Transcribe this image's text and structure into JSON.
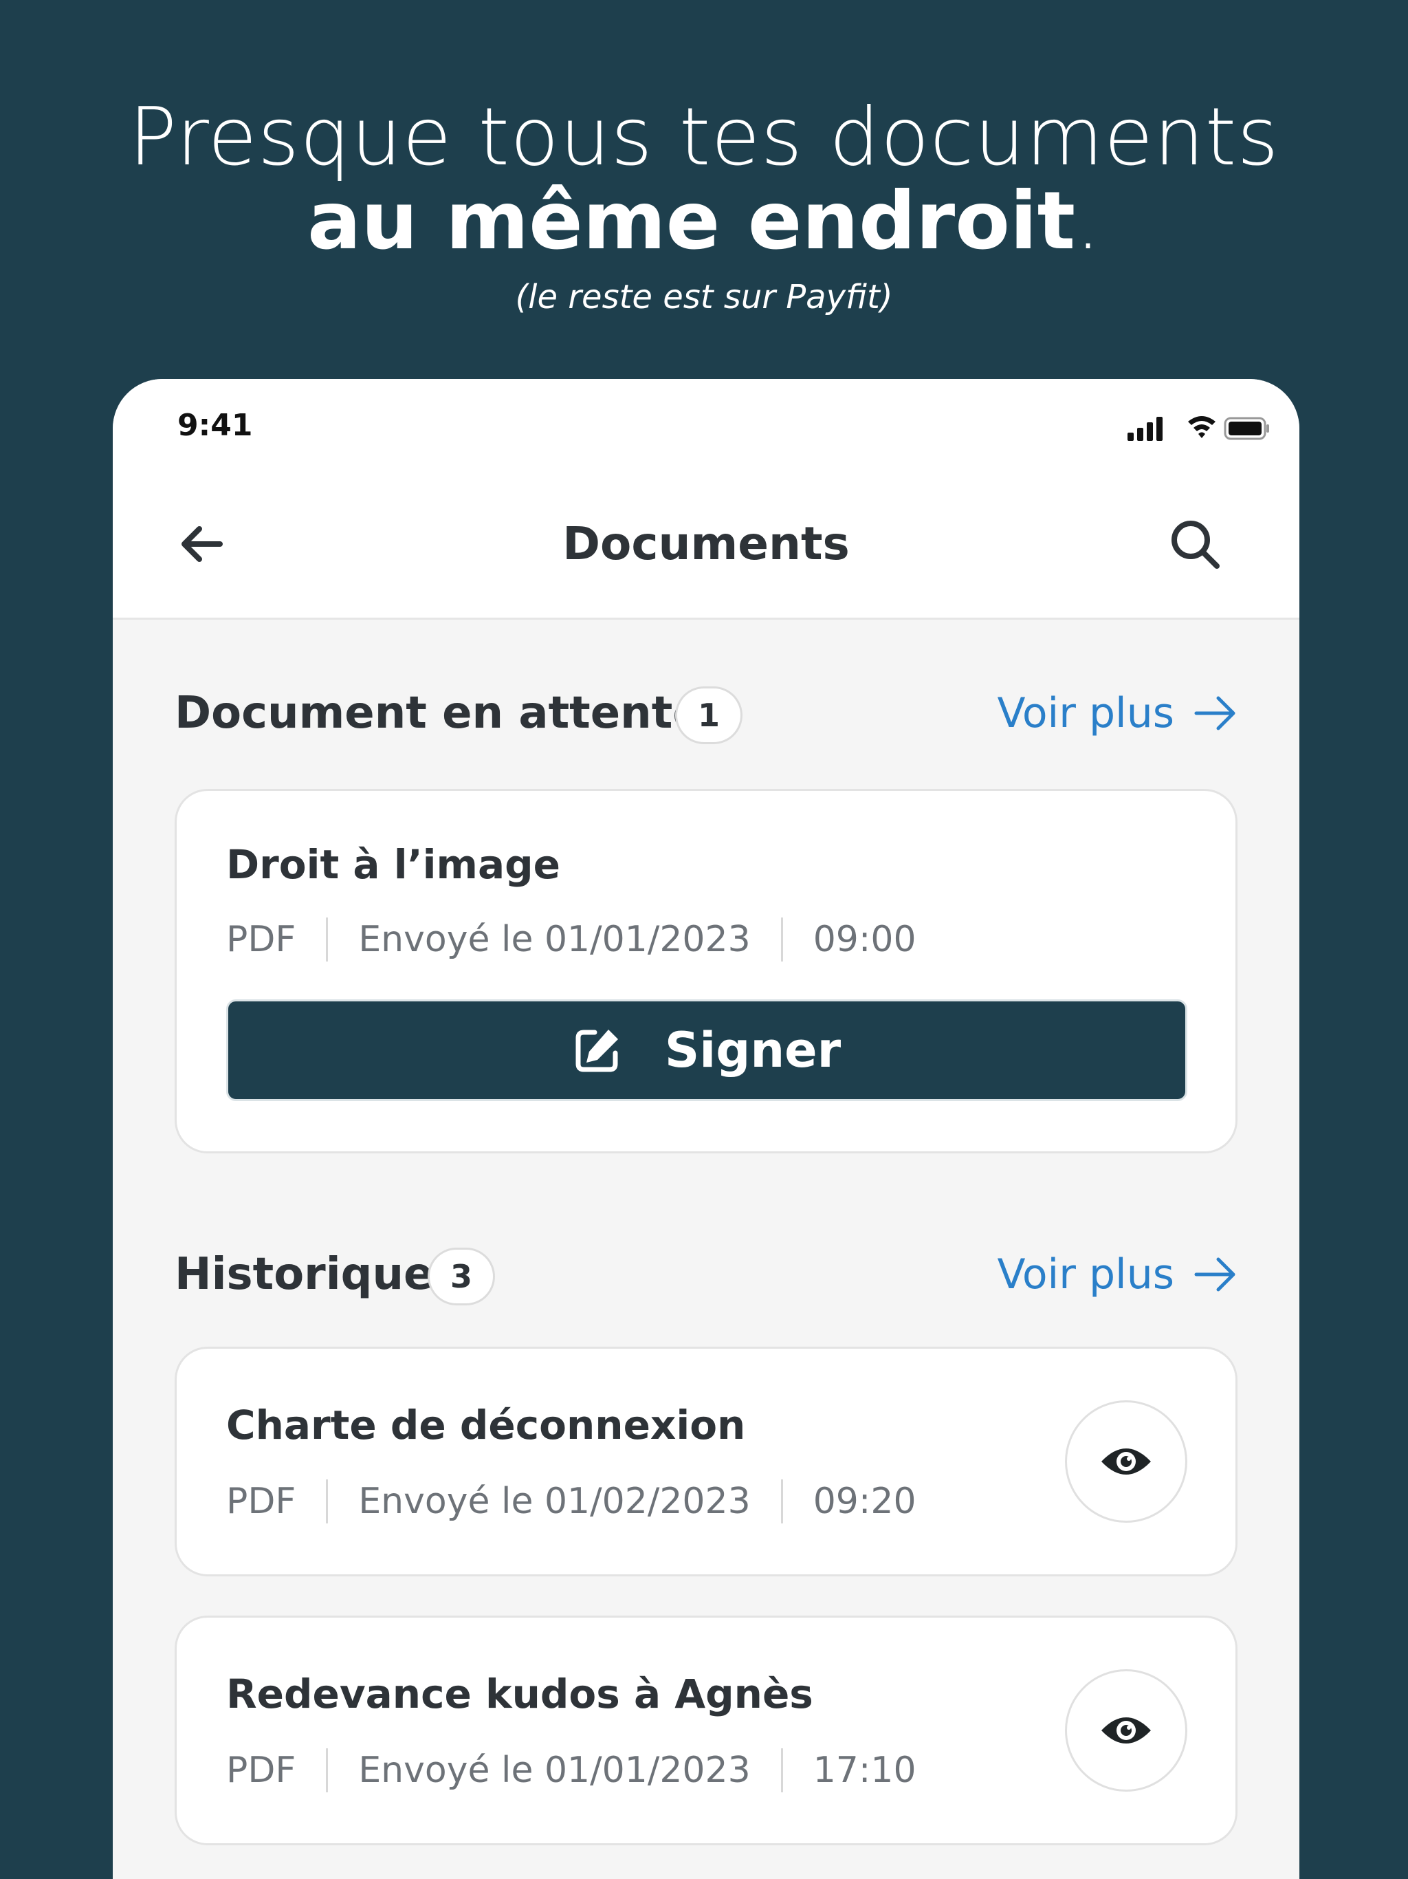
{
  "hero": {
    "line1": "Presque tous tes documents",
    "line2": "au même endroit",
    "line2_dot": ".",
    "subtitle": "(le reste est sur Payfit)"
  },
  "status_bar": {
    "time": "9:41"
  },
  "nav": {
    "title": "Documents"
  },
  "pending": {
    "title": "Document en attente",
    "count": "1",
    "see_more": "Voir plus",
    "items": [
      {
        "title": "Droit à l’image",
        "type": "PDF",
        "sent": "Envoyé le 01/01/2023",
        "time": "09:00",
        "action_label": "Signer"
      }
    ]
  },
  "history": {
    "title": "Historique",
    "count": "3",
    "see_more": "Voir plus",
    "items": [
      {
        "title": "Charte de déconnexion",
        "type": "PDF",
        "sent": "Envoyé le 01/02/2023",
        "time": "09:20"
      },
      {
        "title": "Redevance kudos à Agnès",
        "type": "PDF",
        "sent": "Envoyé le 01/01/2023",
        "time": "17:10"
      }
    ]
  },
  "colors": {
    "background": "#1e3f4d",
    "primary_button": "#1e3f4d",
    "link": "#2a7fc9",
    "text_dark": "#2e3338",
    "text_muted": "#6d7278"
  },
  "icons": {
    "back": "arrow-left-icon",
    "search": "search-icon",
    "see_more": "arrow-right-icon",
    "sign": "edit-square-icon",
    "view": "eye-icon",
    "signal": "cellular-signal-icon",
    "wifi": "wifi-icon",
    "battery": "battery-icon"
  }
}
